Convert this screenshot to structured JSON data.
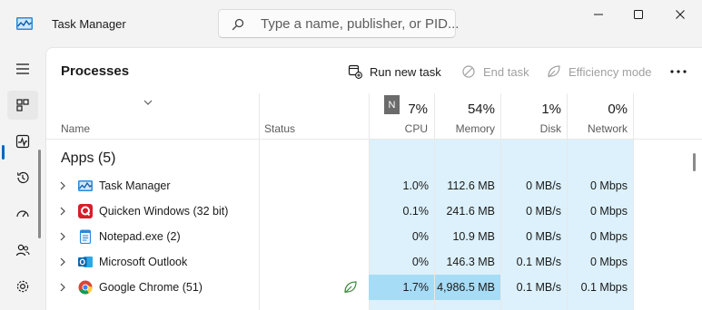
{
  "window": {
    "title": "Task Manager",
    "search_placeholder": "Type a name, publisher, or PID..."
  },
  "nav": [
    "processes",
    "performance",
    "app-history",
    "startup-apps",
    "users",
    "settings"
  ],
  "toolbar": {
    "page_title": "Processes",
    "run_new_task": "Run new task",
    "end_task": "End task",
    "efficiency_mode": "Efficiency mode"
  },
  "columns": {
    "name": "Name",
    "status": "Status",
    "cpu_badge": "N",
    "cpu_pct": "7%",
    "cpu": "CPU",
    "memory_pct": "54%",
    "memory": "Memory",
    "disk_pct": "1%",
    "disk": "Disk",
    "network_pct": "0%",
    "network": "Network"
  },
  "group": {
    "label": "Apps (5)"
  },
  "rows": [
    {
      "name": "Task Manager",
      "icon": "task-manager-icon",
      "cpu": "1.0%",
      "memory": "112.6 MB",
      "disk": "0 MB/s",
      "network": "0 Mbps"
    },
    {
      "name": "Quicken Windows (32 bit)",
      "icon": "quicken-icon",
      "cpu": "0.1%",
      "memory": "241.6 MB",
      "disk": "0 MB/s",
      "network": "0 Mbps"
    },
    {
      "name": "Notepad.exe (2)",
      "icon": "notepad-icon",
      "cpu": "0%",
      "memory": "10.9 MB",
      "disk": "0 MB/s",
      "network": "0 Mbps"
    },
    {
      "name": "Microsoft Outlook",
      "icon": "outlook-icon",
      "cpu": "0%",
      "memory": "146.3 MB",
      "disk": "0.1 MB/s",
      "network": "0 Mbps"
    },
    {
      "name": "Google Chrome (51)",
      "icon": "chrome-icon",
      "cpu": "1.7%",
      "memory": "4,986.5 MB",
      "disk": "0.1 MB/s",
      "network": "0.1 Mbps"
    }
  ],
  "colors": {
    "accent": "#0067c0",
    "heat_light": "#dcf1fc",
    "heat_medium": "#a7dcf6"
  }
}
